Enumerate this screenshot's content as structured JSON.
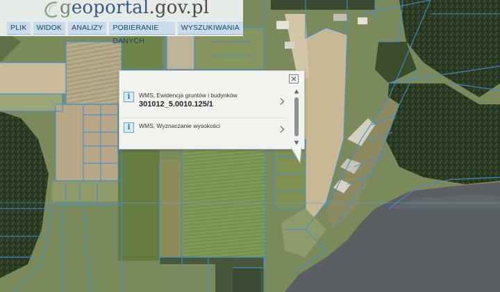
{
  "header": {
    "logo_text_1": "g",
    "logo_text_2": "eoportal",
    "logo_text_3": ".gov.pl"
  },
  "menu": [
    {
      "label": "PLIK"
    },
    {
      "label": "WIDOK"
    },
    {
      "label": "ANALIZY"
    },
    {
      "label": "POBIERANIE DANYCH"
    },
    {
      "label": "WYSZUKIWANIA"
    }
  ],
  "popup": {
    "results": [
      {
        "title": "WMS, Ewidencja gruntów i budynków",
        "value": "301012_5.0010.125/1"
      },
      {
        "title": "WMS, Wyznaczanie wysokości",
        "value": ""
      }
    ]
  },
  "icons": {
    "close": "close-icon",
    "info": "info-icon",
    "arrow": "chevron-right-icon",
    "scroll_up": "triangle-up-icon",
    "scroll_down": "triangle-down-icon"
  },
  "colors": {
    "parcel_lines": "#3d8fd4",
    "water": "#5b5f63",
    "forest": "#27351f",
    "menu_bg": "#c9dcec",
    "menu_text": "#1f3f63"
  }
}
